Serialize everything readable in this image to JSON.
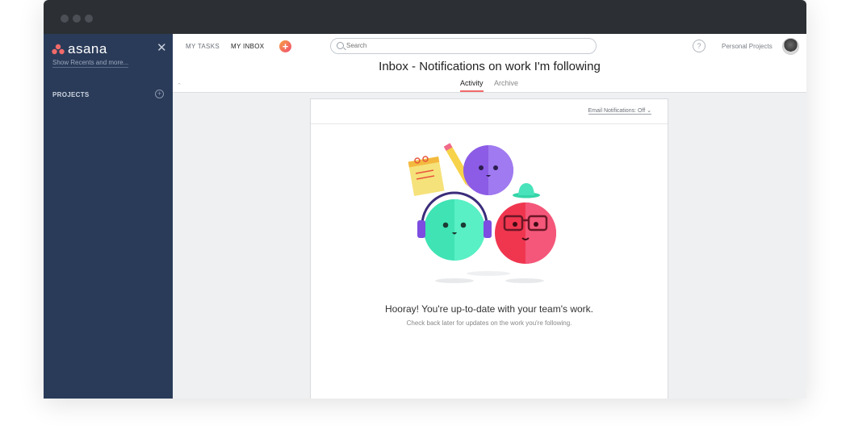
{
  "sidebar": {
    "logo_text": "asana",
    "show_recents": "Show Recents and more...",
    "projects_label": "PROJECTS",
    "close_icon": "close-icon",
    "add_project_icon": "plus-circle-icon"
  },
  "topbar": {
    "tabs": [
      {
        "label": "MY TASKS"
      },
      {
        "label": "MY INBOX"
      }
    ],
    "add_icon": "plus-icon",
    "search_placeholder": "Search",
    "help_label": "?",
    "workspace": "Personal Projects",
    "avatar_icon": "user-avatar"
  },
  "header": {
    "title": "Inbox - Notifications on work I'm following",
    "tabs": [
      {
        "label": "Activity",
        "active": true
      },
      {
        "label": "Archive",
        "active": false
      }
    ]
  },
  "card": {
    "email_notifications": "Email Notifications: Off ⌄",
    "hooray": "Hooray! You're up-to-date with your team's work.",
    "subtext": "Check back later for updates on the work you're following."
  },
  "colors": {
    "sidebar_bg": "#2a3b59",
    "accent": "#f06a6a",
    "purple": "#8c5ce6",
    "teal": "#3fe3b4",
    "red": "#f0364f"
  }
}
